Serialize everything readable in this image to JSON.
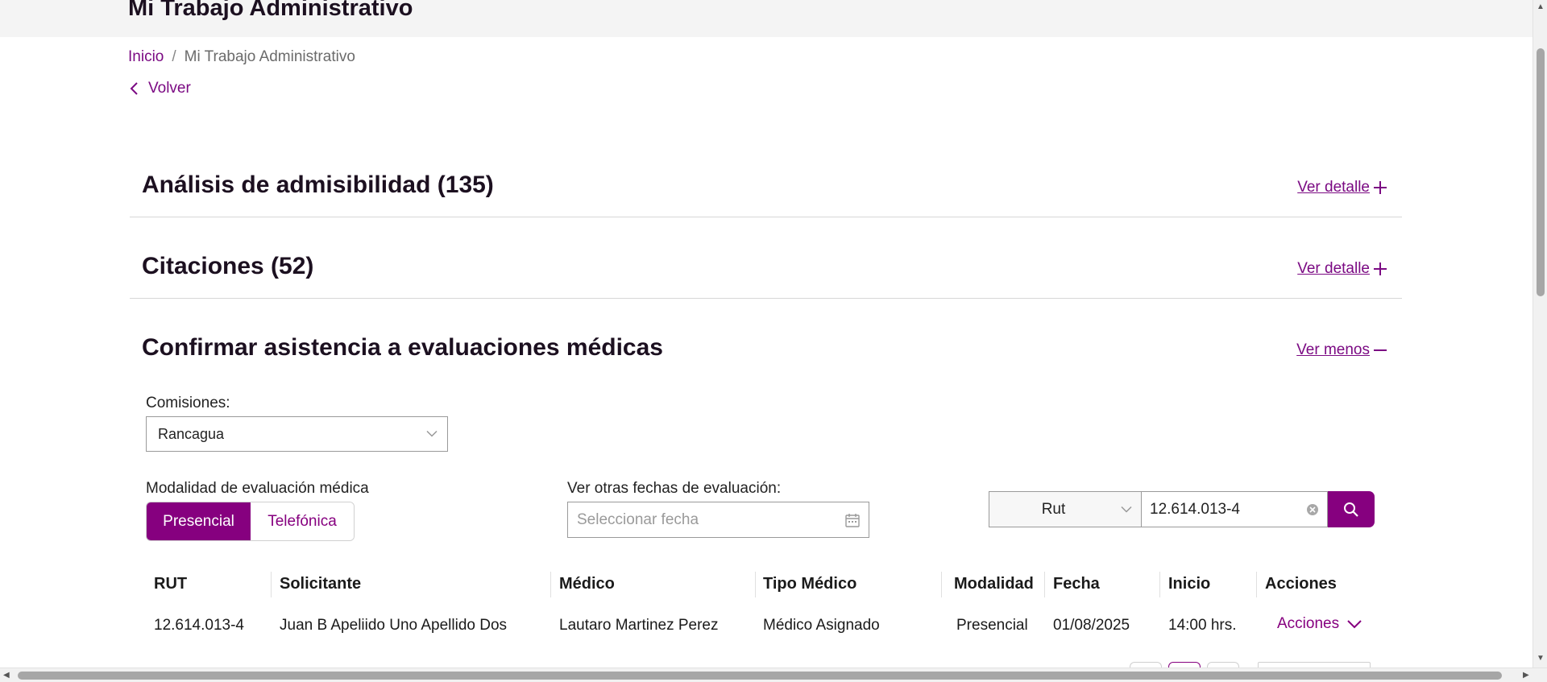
{
  "header": {
    "title": "Mi Trabajo Administrativo"
  },
  "breadcrumb": {
    "home": "Inicio",
    "separator": "/",
    "current": "Mi Trabajo Administrativo"
  },
  "back": {
    "label": "Volver"
  },
  "sections": [
    {
      "title": "Análisis de admisibilidad (135)",
      "toggle_label": "Ver detalle",
      "toggle_icon": "plus-icon"
    },
    {
      "title": "Citaciones (52)",
      "toggle_label": "Ver detalle",
      "toggle_icon": "plus-icon"
    },
    {
      "title": "Confirmar asistencia a evaluaciones médicas",
      "toggle_label": "Ver menos",
      "toggle_icon": "minus-icon"
    }
  ],
  "filters": {
    "comisiones_label": "Comisiones:",
    "comisiones_value": "Rancagua",
    "modalidad_label": "Modalidad de evaluación médica",
    "modalidad_options": [
      "Presencial",
      "Telefónica"
    ],
    "modalidad_selected": "Presencial",
    "fecha_label": "Ver otras fechas de evaluación:",
    "fecha_placeholder": "Seleccionar fecha",
    "search_type": "Rut",
    "search_value": "12.614.013-4"
  },
  "table": {
    "headers": [
      "RUT",
      "Solicitante",
      "Médico",
      "Tipo Médico",
      "Modalidad",
      "Fecha",
      "Inicio",
      "Acciones"
    ],
    "rows": [
      [
        "12.614.013-4",
        "Juan B Apeliido Uno Apellido Dos",
        "Lautaro Martinez Perez",
        "Médico Asignado",
        "Presencial",
        "01/08/2025",
        "14:00 hrs.",
        "Acciones"
      ]
    ]
  },
  "colors": {
    "accent": "#86007f",
    "link": "#7b0a83",
    "title": "#1c1020",
    "topbar": "#f4f4f4"
  }
}
